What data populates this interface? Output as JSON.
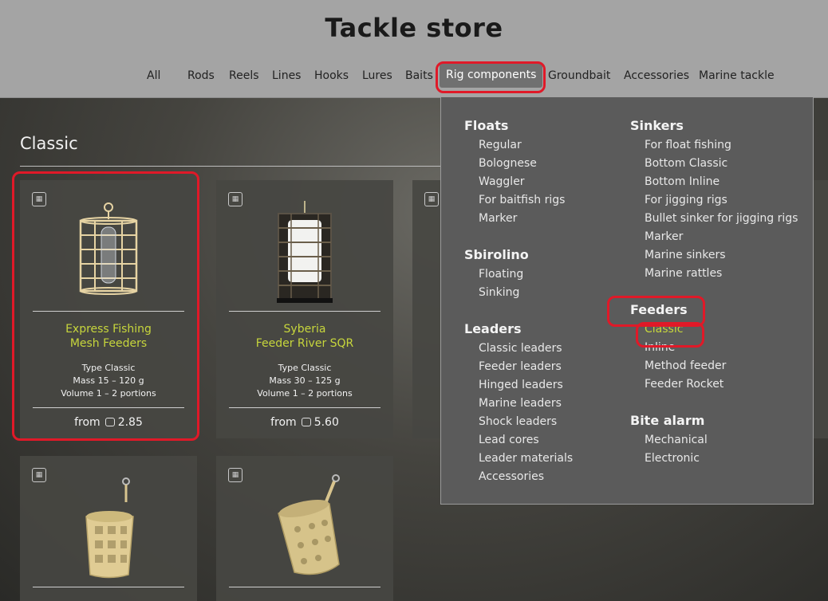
{
  "store": {
    "title": "Tackle store",
    "nav": [
      "All",
      "Rods",
      "Reels",
      "Lines",
      "Hooks",
      "Lures",
      "Baits",
      "Rig components",
      "Groundbait",
      "Accessories",
      "Marine tackle"
    ],
    "active_nav": "Rig components"
  },
  "section": {
    "title": "Classic"
  },
  "products": [
    {
      "name_line1": "Express Fishing",
      "name_line2": "Mesh Feeders",
      "type": "Type Classic",
      "mass": "Mass 15 – 120 g",
      "volume": "Volume 1 – 2 portions",
      "price_prefix": "from",
      "price": "2.85"
    },
    {
      "name_line1": "Syberia",
      "name_line2": "Feeder River SQR",
      "type": "Type Classic",
      "mass": "Mass 30 – 125 g",
      "volume": "Volume 1 – 2 portions",
      "price_prefix": "from",
      "price": "5.60"
    }
  ],
  "menu": {
    "floats": {
      "title": "Floats",
      "items": [
        "Regular",
        "Bolognese",
        "Waggler",
        "For baitfish rigs",
        "Marker"
      ]
    },
    "sbirolino": {
      "title": "Sbirolino",
      "items": [
        "Floating",
        "Sinking"
      ]
    },
    "leaders": {
      "title": "Leaders",
      "items": [
        "Classic leaders",
        "Feeder leaders",
        "Hinged leaders",
        "Marine leaders",
        "Shock leaders",
        "Lead cores",
        "Leader materials",
        "Accessories"
      ]
    },
    "sinkers": {
      "title": "Sinkers",
      "items": [
        "For float fishing",
        "Bottom Classic",
        "Bottom Inline",
        "For jigging rigs",
        "Bullet sinker for jigging rigs",
        "Marker",
        "Marine sinkers",
        "Marine rattles"
      ]
    },
    "feeders": {
      "title": "Feeders",
      "items": [
        "Classic",
        "Inline",
        "Method feeder",
        "Feeder Rocket"
      ],
      "selected": "Classic"
    },
    "bite_alarm": {
      "title": "Bite alarm",
      "items": [
        "Mechanical",
        "Electronic"
      ]
    }
  },
  "colors": {
    "highlight": "#e01928",
    "accent": "#c7d63c",
    "header": "#a4a4a4"
  }
}
